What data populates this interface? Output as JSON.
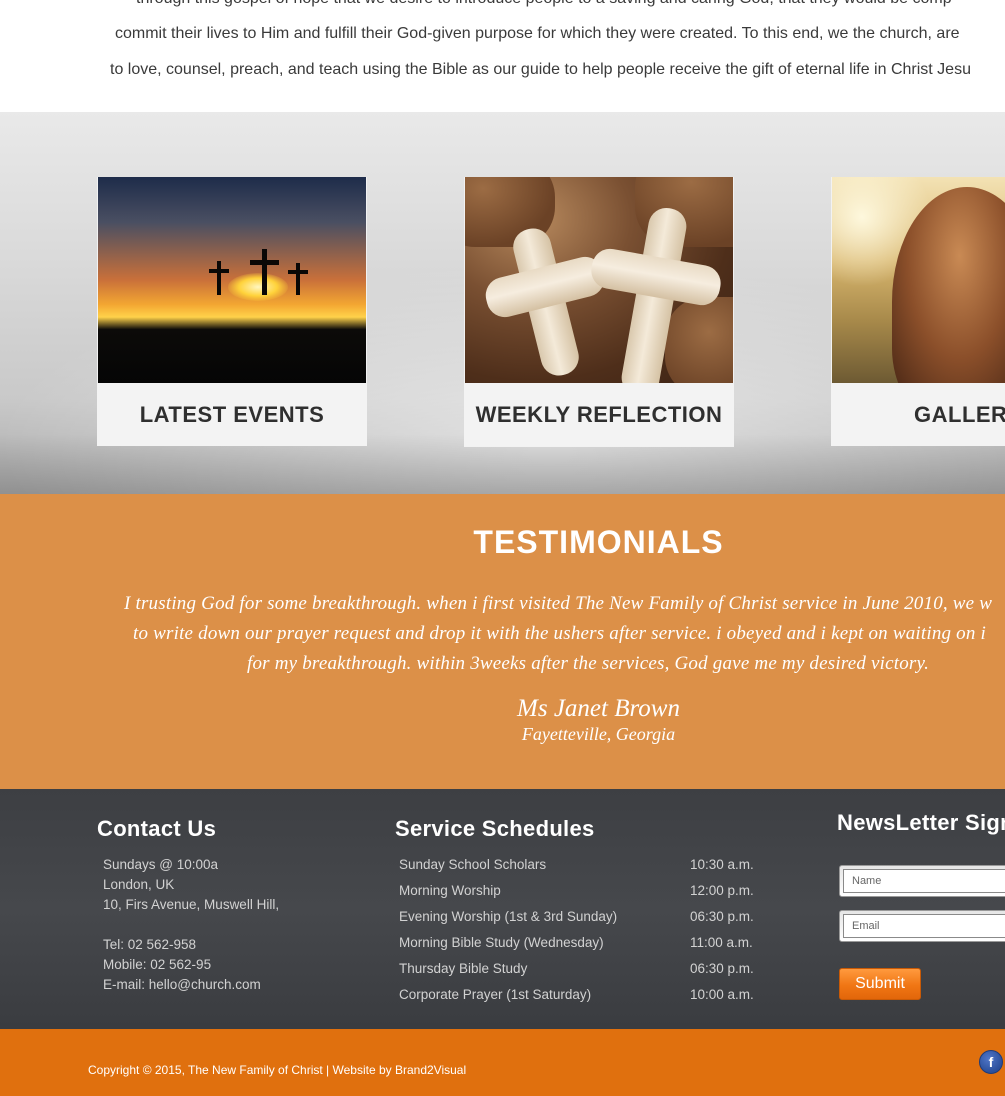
{
  "intro": {
    "lines": [
      "through this gospel of hope that we desire to introduce people to a saving and caring God, that they would be comp",
      "commit their lives to Him and fulfill their God-given purpose for which they were created. To this end, we the church, are",
      "to love, counsel, preach, and teach using the Bible as our guide to help people receive the gift of eternal life in Christ Jesu"
    ]
  },
  "features": {
    "cards": [
      {
        "title": "LATEST EVENTS"
      },
      {
        "title": "WEEKLY REFLECTION"
      },
      {
        "title": "GALLERY"
      }
    ]
  },
  "testimonials": {
    "heading": "TESTIMONIALS",
    "quote_lines": [
      "I trusting God for some breakthrough. when i first visited The New Family of Christ service in June 2010, we w",
      "to write down our prayer request and drop it with the ushers after service. i obeyed and i kept on waiting on i",
      "for my breakthrough. within 3weeks after the services, God gave me my desired victory."
    ],
    "name": "Ms Janet Brown",
    "location": "Fayetteville, Georgia"
  },
  "contact": {
    "heading": "Contact Us",
    "lines": [
      "Sundays @ 10:00a",
      "London, UK",
      "10, Firs Avenue, Muswell Hill,",
      "Tel: 02 562-958",
      "Mobile: 02 562-95",
      "E-mail: hello@church.com"
    ]
  },
  "schedules": {
    "heading": "Service Schedules",
    "rows": [
      {
        "name": "Sunday School Scholars",
        "time": "10:30 a.m."
      },
      {
        "name": "Morning Worship",
        "time": "12:00 p.m."
      },
      {
        "name": "Evening Worship (1st & 3rd Sunday)",
        "time": "06:30 p.m."
      },
      {
        "name": "Morning Bible Study (Wednesday)",
        "time": "11:00 a.m."
      },
      {
        "name": "Thursday Bible Study",
        "time": "06:30 p.m."
      },
      {
        "name": "Corporate Prayer (1st Saturday)",
        "time": "10:00 a.m."
      }
    ]
  },
  "newsletter": {
    "heading": "NewsLetter Sign",
    "name_placeholder": "Name",
    "email_placeholder": "Email",
    "submit_label": "Submit"
  },
  "footer": {
    "copyright": "Copyright © 2015, The New Family of Christ  |  Website by Brand2Visual",
    "social_icon": "facebook-icon",
    "social_glyph": "f"
  },
  "colors": {
    "testimonial_bg": "#dc9048",
    "footer_bg": "#3d3f43",
    "copyright_bg": "#e0700e",
    "accent": "#f07614"
  }
}
